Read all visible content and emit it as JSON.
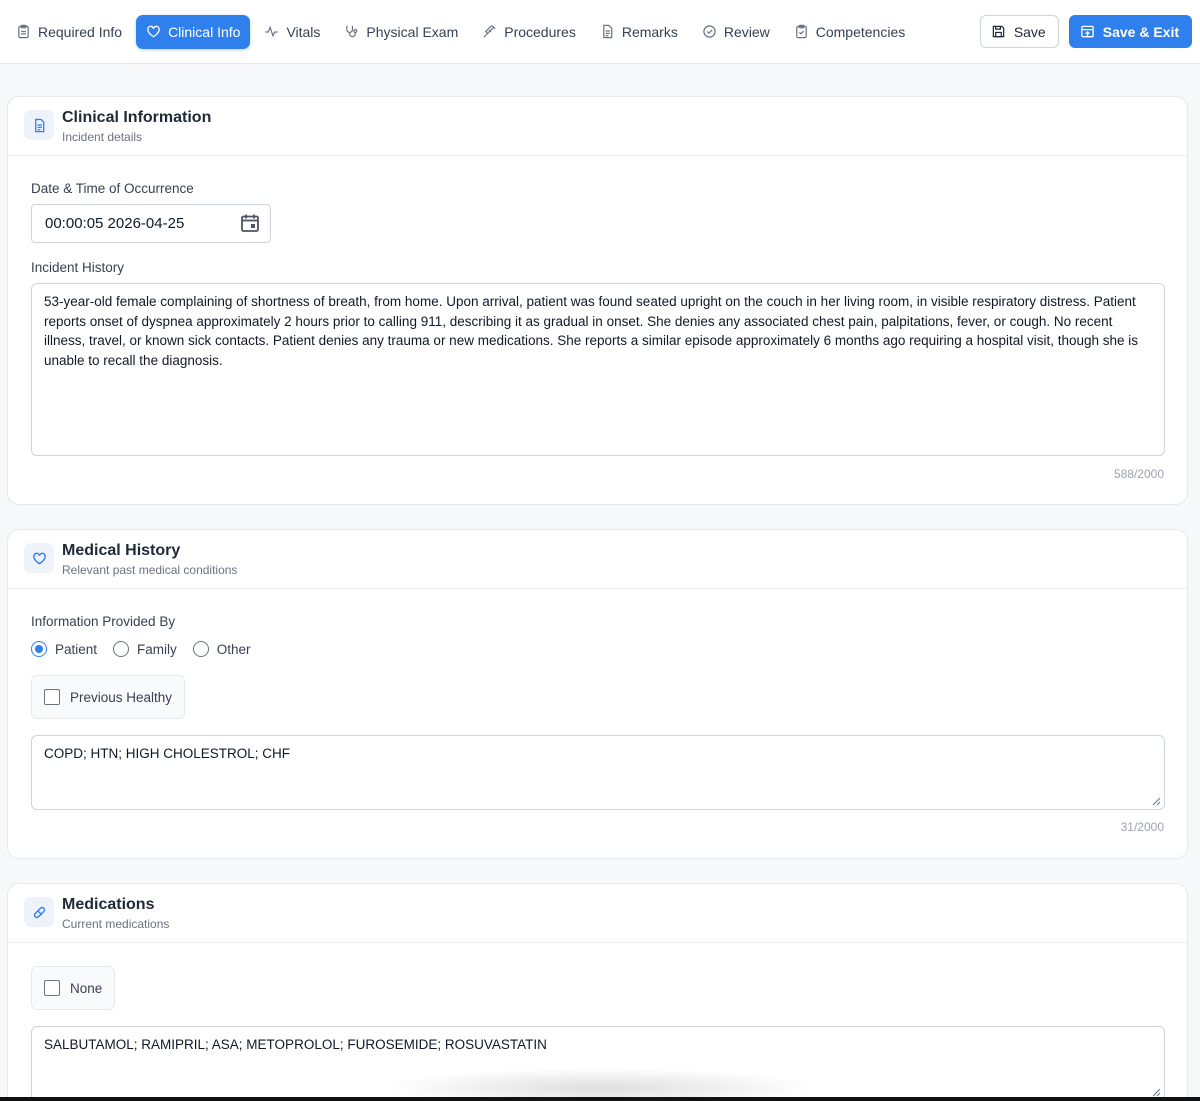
{
  "tabs": [
    {
      "label": "Required Info",
      "icon": "clipboard-icon"
    },
    {
      "label": "Clinical Info",
      "icon": "heart-icon"
    },
    {
      "label": "Vitals",
      "icon": "activity-icon"
    },
    {
      "label": "Physical Exam",
      "icon": "stethoscope-icon"
    },
    {
      "label": "Procedures",
      "icon": "syringe-icon"
    },
    {
      "label": "Remarks",
      "icon": "file-text-icon"
    },
    {
      "label": "Review",
      "icon": "check-circle-icon"
    },
    {
      "label": "Competencies",
      "icon": "clipboard-check-icon"
    }
  ],
  "active_tab": "Clinical Info",
  "toolbar": {
    "save_label": "Save",
    "save_exit_label": "Save & Exit"
  },
  "clinical": {
    "title": "Clinical Information",
    "subtitle": "Incident details",
    "datetime_label": "Date & Time of Occurrence",
    "datetime_value": "00:00:05 2026-04-25",
    "history_label": "Incident History",
    "history_text": " 53-year-old female complaining of shortness of breath, from home. Upon arrival, patient was found seated upright on the couch in her living room, in visible respiratory distress. Patient reports onset of dyspnea approximately 2 hours prior to calling 911, describing it as gradual in onset. She denies any associated chest pain, palpitations, fever, or cough. No recent illness, travel, or known sick contacts. Patient denies any trauma or new medications. She reports a similar episode approximately 6 months ago requiring a hospital visit, though she is unable to recall the diagnosis.",
    "history_counter": "588/2000"
  },
  "medical_history": {
    "title": "Medical History",
    "subtitle": "Relevant past medical conditions",
    "provided_by_label": "Information Provided By",
    "options": [
      "Patient",
      "Family",
      "Other"
    ],
    "selected": "Patient",
    "previous_healthy_label": "Previous Healthy",
    "previous_healthy_checked": false,
    "conditions_text": "COPD; HTN; HIGH CHOLESTROL; CHF",
    "counter": "31/2000"
  },
  "medications": {
    "title": "Medications",
    "subtitle": "Current medications",
    "none_label": "None",
    "none_checked": false,
    "text": "SALBUTAMOL; RAMIPRIL; ASA; METOPROLOL; FUROSEMIDE; ROSUVASTATIN"
  },
  "colors": {
    "accent": "#2f80ed",
    "background": "#f7f8fa",
    "border": "#e6e8ec"
  }
}
